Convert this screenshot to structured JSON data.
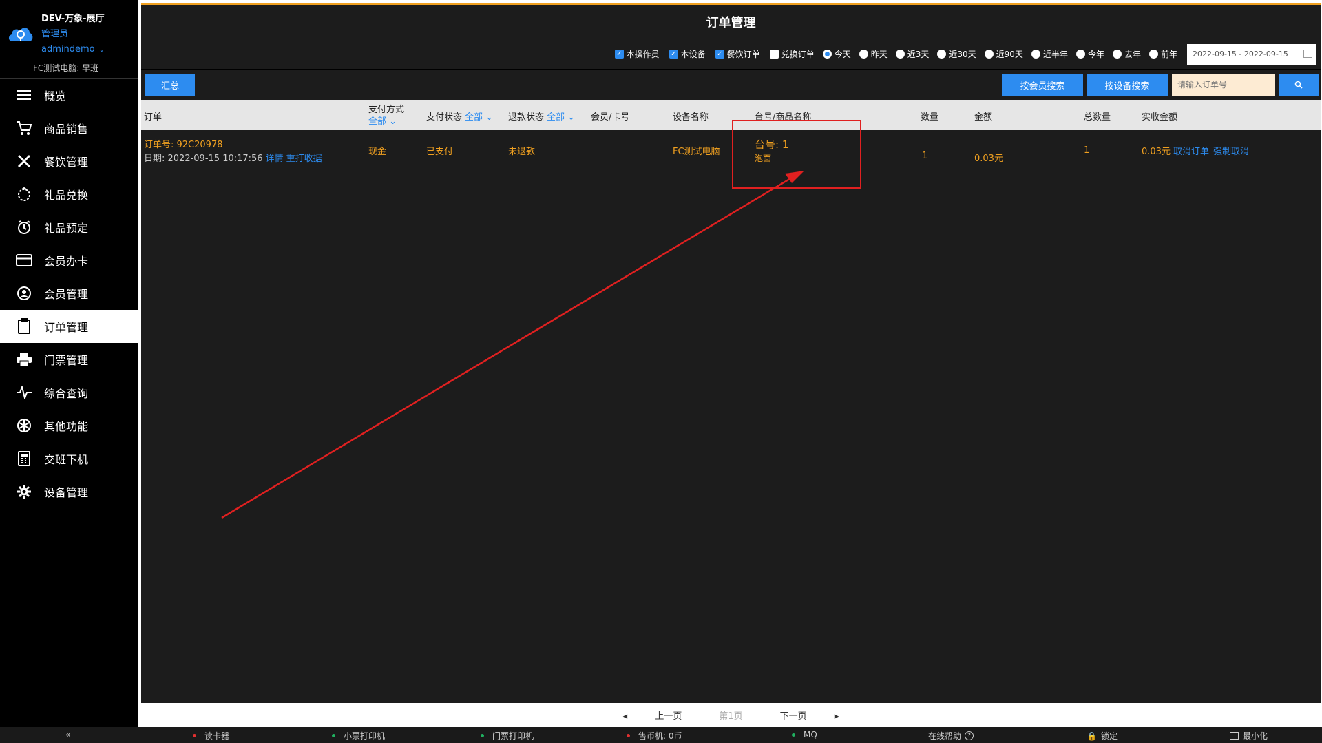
{
  "sidebar": {
    "app_title": "DEV-万象-展厅",
    "role": "管理员",
    "username": "admindemo",
    "shift": "FC测试电脑: 早班",
    "items": [
      {
        "label": "概览",
        "icon": "menu-icon"
      },
      {
        "label": "商品销售",
        "icon": "cart-icon"
      },
      {
        "label": "餐饮管理",
        "icon": "utensils-icon"
      },
      {
        "label": "礼品兑换",
        "icon": "gift-icon"
      },
      {
        "label": "礼品预定",
        "icon": "alarm-clock-icon"
      },
      {
        "label": "会员办卡",
        "icon": "card-icon"
      },
      {
        "label": "会员管理",
        "icon": "user-icon"
      },
      {
        "label": "订单管理",
        "icon": "clipboard-icon"
      },
      {
        "label": "门票管理",
        "icon": "printer-icon"
      },
      {
        "label": "综合查询",
        "icon": "pulse-icon"
      },
      {
        "label": "其他功能",
        "icon": "aperture-icon"
      },
      {
        "label": "交班下机",
        "icon": "calculator-icon"
      },
      {
        "label": "设备管理",
        "icon": "gear-icon"
      }
    ],
    "active_item": "订单管理",
    "collapse_label": "«"
  },
  "page": {
    "title": "订单管理"
  },
  "filters": {
    "checkboxes": [
      {
        "label": "本操作员",
        "checked": true
      },
      {
        "label": "本设备",
        "checked": true
      },
      {
        "label": "餐饮订单",
        "checked": true
      },
      {
        "label": "兑换订单",
        "checked": false
      }
    ],
    "ranges": [
      {
        "label": "今天",
        "selected": true
      },
      {
        "label": "昨天",
        "selected": false
      },
      {
        "label": "近3天",
        "selected": false
      },
      {
        "label": "近30天",
        "selected": false
      },
      {
        "label": "近90天",
        "selected": false
      },
      {
        "label": "近半年",
        "selected": false
      },
      {
        "label": "今年",
        "selected": false
      },
      {
        "label": "去年",
        "selected": false
      },
      {
        "label": "前年",
        "selected": false
      }
    ],
    "date_range": "2022-09-15 - 2022-09-15"
  },
  "actions": {
    "summary": "汇总",
    "member_search": "按会员搜索",
    "device_search": "按设备搜索",
    "order_placeholder": "请输入订单号"
  },
  "table": {
    "headers": {
      "order": "订单",
      "pay_method": "支付方式",
      "pay_method_filter": "全部",
      "pay_status": "支付状态",
      "pay_status_filter": "全部",
      "refund_status": "退款状态",
      "refund_status_filter": "全部",
      "member": "会员/卡号",
      "device": "设备名称",
      "table_goods": "台号/商品名称",
      "qty": "数量",
      "amount": "金额",
      "total_qty": "总数量",
      "actual_amount": "实收金额"
    },
    "rows": [
      {
        "order_no": "订单号: 92C20978",
        "date": "日期: 2022-09-15 10:17:56",
        "detail_link": "详情",
        "reprint_link": "重打收据",
        "pay_method": "现金",
        "pay_status": "已支付",
        "refund_status": "未退款",
        "device": "FC测试电脑",
        "table_no": "台号: 1",
        "goods": "泡面",
        "qty": "1",
        "amount": "0.03元",
        "total_qty": "1",
        "actual_amount": "0.03元",
        "cancel_link": "取消订单",
        "force_cancel_link": "强制取消"
      }
    ]
  },
  "pager": {
    "prev": "上一页",
    "current": "第1页",
    "next": "下一页"
  },
  "status_bar": {
    "card_reader": "读卡器",
    "ticket_printer": "小票打印机",
    "admission_printer": "门票打印机",
    "coin_machine": "售币机: 0币",
    "mq": "MQ",
    "help": "在线帮助",
    "lock": "锁定",
    "minimize": "最小化"
  },
  "colors": {
    "accent": "#2d8cf0",
    "warning": "#f0a020",
    "annotation": "#e02020"
  }
}
